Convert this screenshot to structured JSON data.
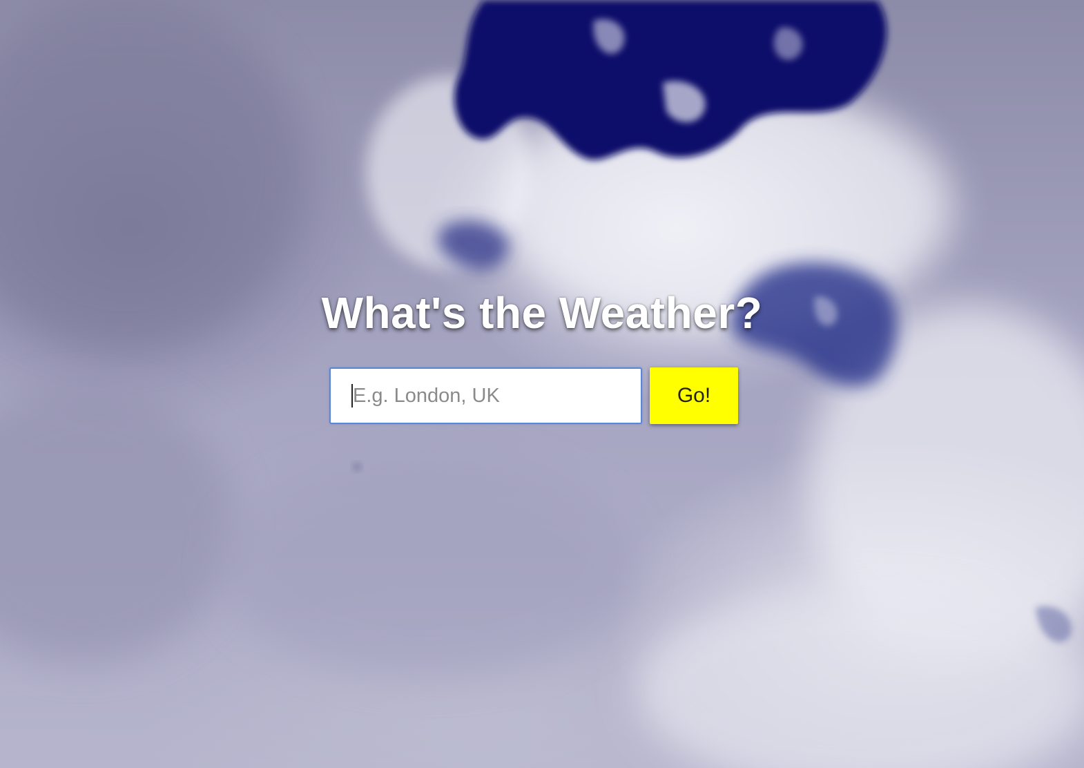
{
  "page": {
    "title": "What's the Weather?"
  },
  "search": {
    "placeholder": "E.g. London, UK",
    "value": "",
    "button_label": "Go!"
  },
  "colors": {
    "button_bg": "#ffff00",
    "input_border": "#5a86d6",
    "title_text": "#ffffff",
    "sky_dark_blue": "#0b1166"
  },
  "background": {
    "image": "cloudy-sky-photo"
  }
}
